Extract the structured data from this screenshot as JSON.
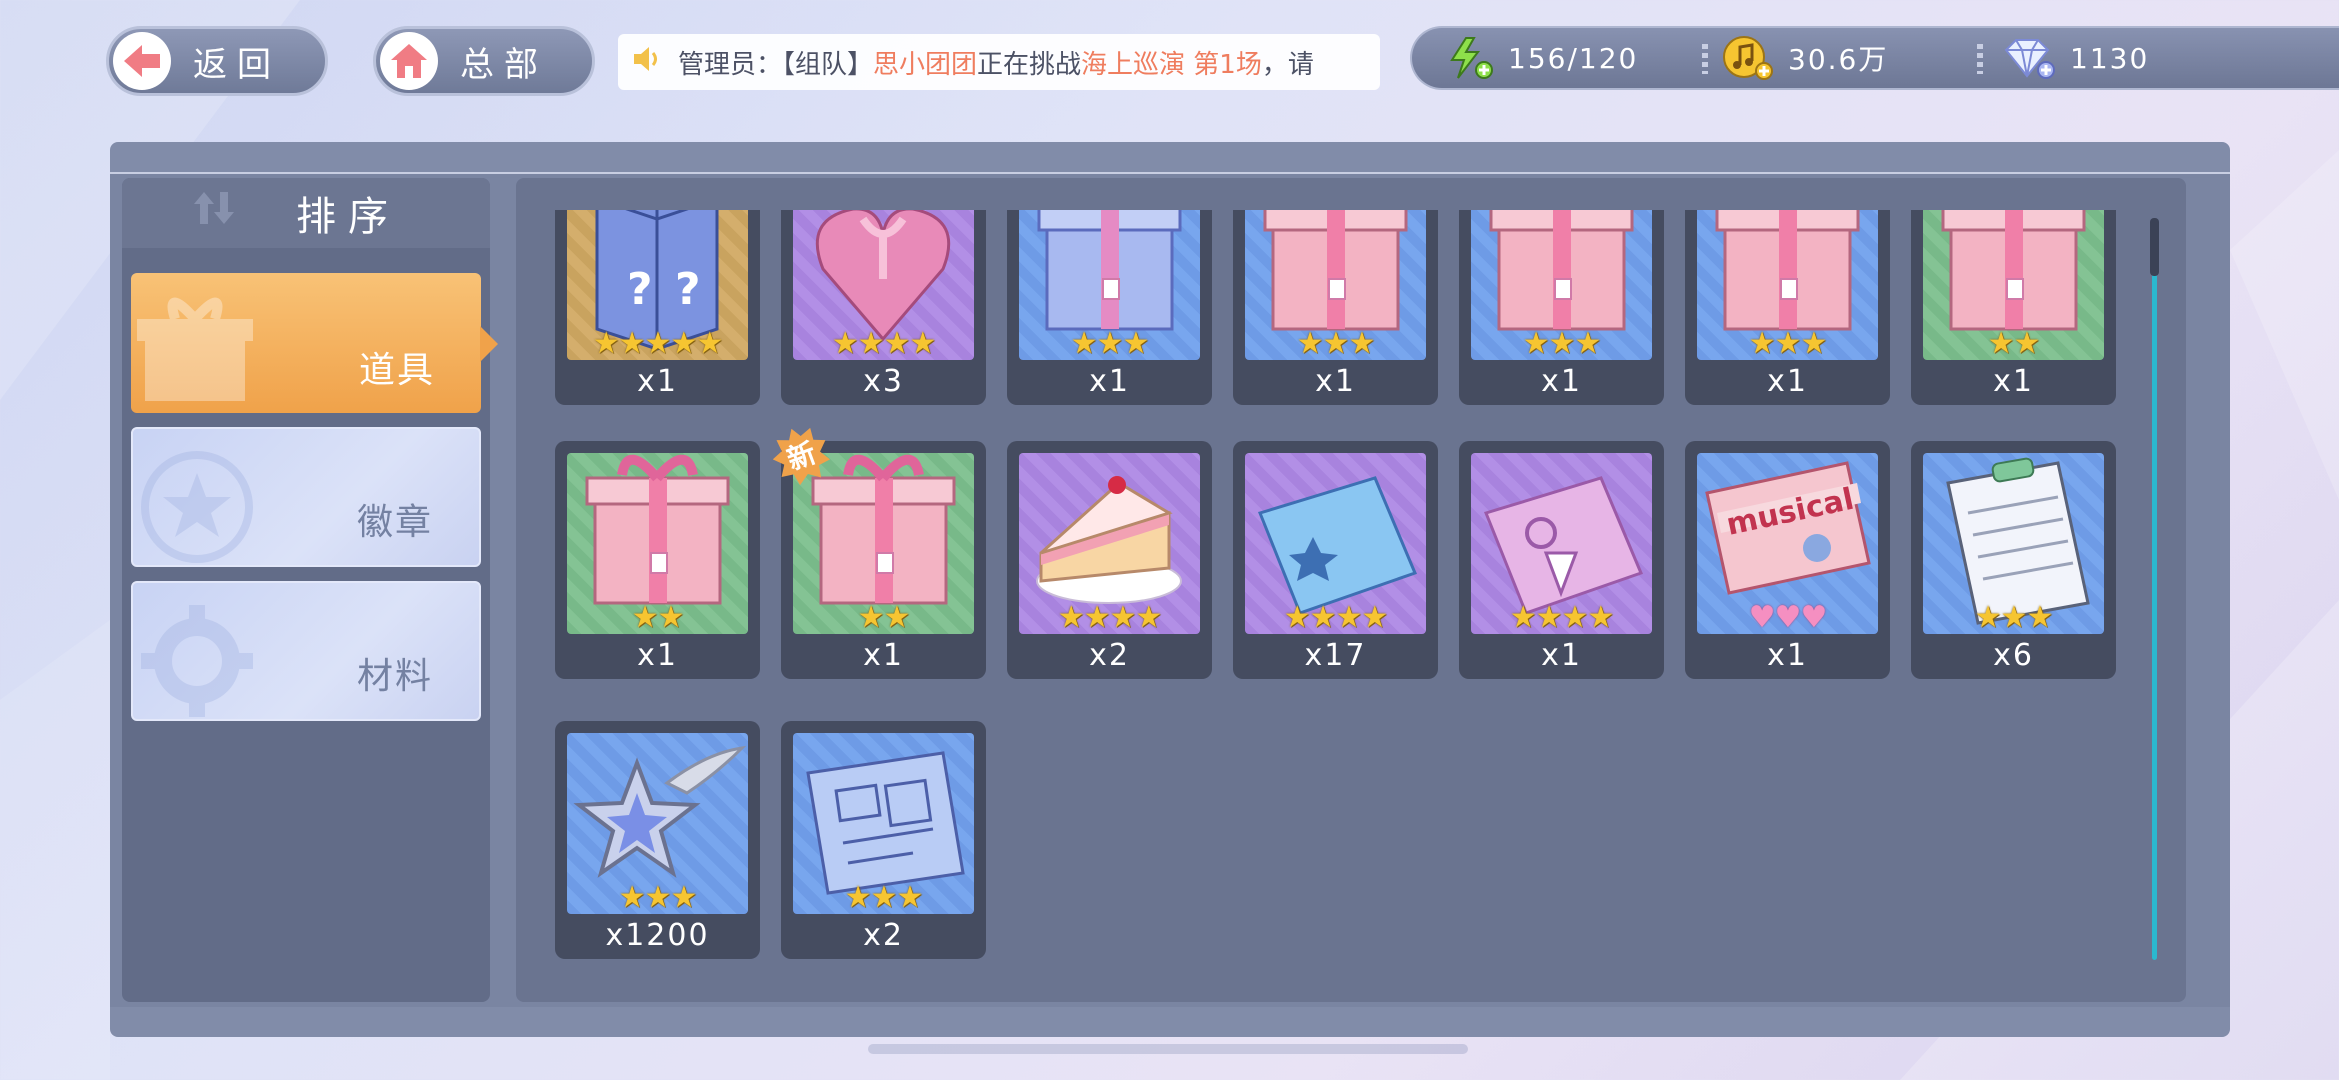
{
  "topbar": {
    "back_label": "返回",
    "hq_label": "总部",
    "notice": {
      "prefix": "管理员：【组队】",
      "team": "思小团团",
      "mid": "正在挑战",
      "event": "海上巡演 第1场",
      "suffix": "，请"
    },
    "resources": {
      "energy": "156/120",
      "coins": "30.6万",
      "diamonds": "1130"
    }
  },
  "sidebar": {
    "sort_label": "排序",
    "categories": [
      {
        "label": "道具",
        "active": true
      },
      {
        "label": "徽章",
        "active": false
      },
      {
        "label": "材料",
        "active": false
      }
    ]
  },
  "items": [
    {
      "icon": "mystery-box-icon",
      "stars": 5,
      "qty": "x1"
    },
    {
      "icon": "heart-box-icon",
      "stars": 4,
      "qty": "x3"
    },
    {
      "icon": "blue-gift-icon",
      "stars": 3,
      "qty": "x1"
    },
    {
      "icon": "pink-gift-icon",
      "stars": 3,
      "qty": "x1"
    },
    {
      "icon": "pink-gift-icon",
      "stars": 3,
      "qty": "x1"
    },
    {
      "icon": "pink-gift-icon",
      "stars": 3,
      "qty": "x1"
    },
    {
      "icon": "pink-gift-icon",
      "stars": 2,
      "qty": "x1"
    },
    {
      "icon": "pink-gift-icon",
      "stars": 2,
      "qty": "x1"
    },
    {
      "icon": "pink-gift-icon",
      "stars": 2,
      "qty": "x1",
      "badge": "新"
    },
    {
      "icon": "cake-icon",
      "stars": 4,
      "qty": "x2"
    },
    {
      "icon": "blue-card-icon",
      "stars": 4,
      "qty": "x17"
    },
    {
      "icon": "purple-card-icon",
      "stars": 4,
      "qty": "x1"
    },
    {
      "icon": "musical-ticket-icon",
      "hearts": 3,
      "qty": "x1",
      "ticket_text": "musical"
    },
    {
      "icon": "clipboard-icon",
      "stars": 3,
      "qty": "x6"
    },
    {
      "icon": "winged-star-icon",
      "stars": 3,
      "qty": "x1200"
    },
    {
      "icon": "blueprint-icon",
      "stars": 3,
      "qty": "x2"
    }
  ],
  "colors": {
    "accent_orange": "#f0a24a",
    "notice_highlight": "#ef7d5f",
    "scrollbar": "#2bb8cf"
  }
}
